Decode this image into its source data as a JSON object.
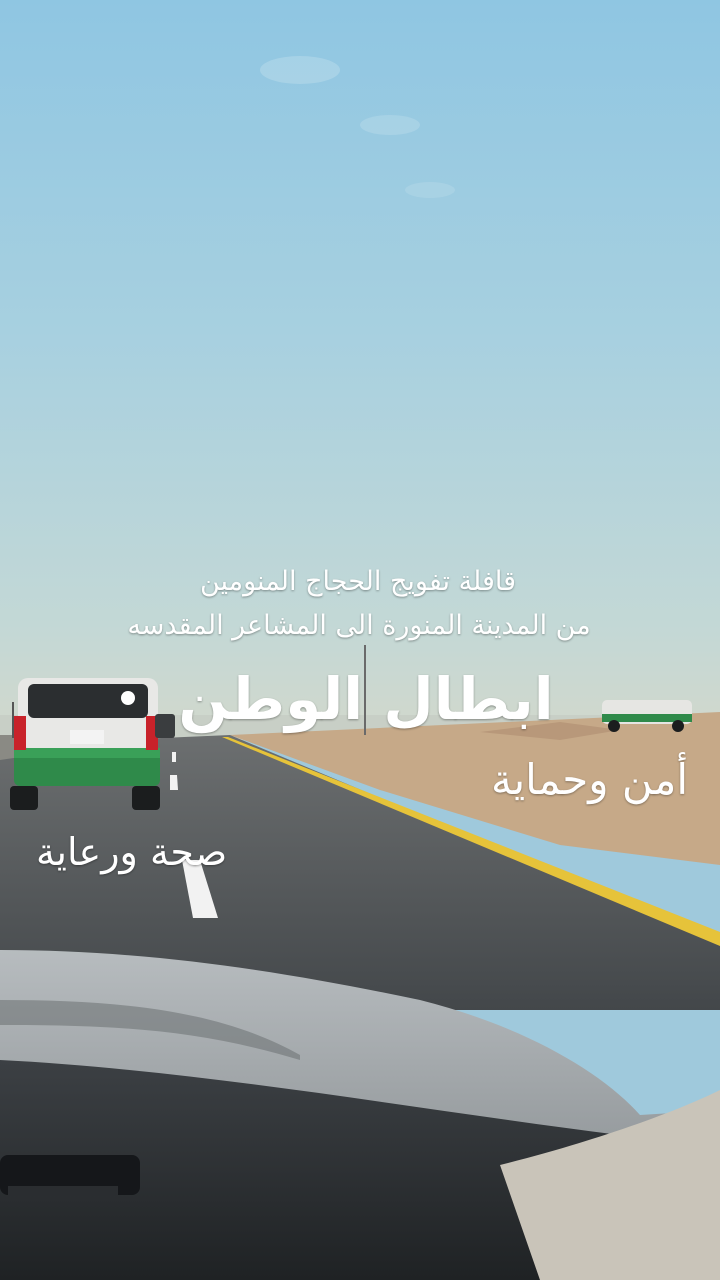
{
  "captions": {
    "line1": "قافلة تفويج الحجاج المنومين",
    "line2": "من المدينة المنورة الى المشاعر المقدسه",
    "headline": "ابطال الوطن",
    "security": "أمن وحماية",
    "health": "صحة ورعاية"
  },
  "colors": {
    "sky_top": "#9cc9e0",
    "sky_horizon": "#c9d8d2",
    "road": "#4b4f52",
    "desert": "#c8ab8a",
    "lane_yellow": "#e8c63a",
    "vehicle_green": "#2f8a4a",
    "caption_text": "#ffffff"
  }
}
